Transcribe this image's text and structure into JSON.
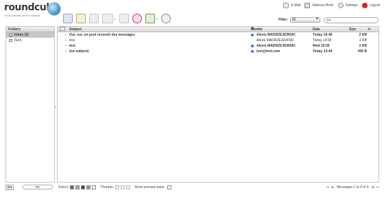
{
  "logo": {
    "name": "roundcube",
    "tagline": "Free webmail for the masses"
  },
  "topnav": [
    {
      "label": "E-Mail",
      "icon": "mail-icon"
    },
    {
      "label": "Address Book",
      "icon": "address-book-icon"
    },
    {
      "label": "Settings",
      "icon": "settings-icon"
    },
    {
      "label": "Logout",
      "icon": "logout-icon"
    }
  ],
  "toolbar": {
    "icons": [
      "check-mail-icon",
      "compose-icon",
      "reply-icon",
      "reply-all-icon",
      "forward-icon",
      "delete-icon",
      "mark-icon",
      "more-actions-icon"
    ]
  },
  "filter": {
    "label": "Filter:",
    "value": "All"
  },
  "search": {
    "value": ""
  },
  "folders": {
    "title": "Folders",
    "items": [
      {
        "label": "Inbox (3)",
        "selected": true
      },
      {
        "label": "Sent",
        "selected": false
      }
    ]
  },
  "messages": {
    "columns": {
      "subject": "Subject",
      "sender": "Sender",
      "date": "Date",
      "size": "Size"
    },
    "rows": [
      {
        "subject": "Oui, oui, on peut recevoir des messages",
        "sender": "Alexis MADRZEJEWSKI",
        "date": "Today 19:45",
        "size": "2 KB",
        "unread": true
      },
      {
        "subject": "test",
        "sender": "Alexis MADRZEJEWSKI",
        "date": "Today 14:08",
        "size": "2 KB",
        "unread": false
      },
      {
        "subject": "test",
        "sender": "Alexis MADRZEJEWSKI",
        "date": "Wed 15:55",
        "size": "2 KB",
        "unread": true
      },
      {
        "subject": "(no subject)",
        "sender": "test@test.com",
        "date": "Today 13:44",
        "size": "496 B",
        "unread": true
      }
    ]
  },
  "footer": {
    "quota": "0%",
    "select_label": "Select:",
    "threads_label": "Threads:",
    "preview_label": "Show preview pane:",
    "count": "Messages 1 to 4 of 4"
  },
  "colors": {
    "accent": "#2e7ad6",
    "selected_folder": "#c8c8c8"
  }
}
